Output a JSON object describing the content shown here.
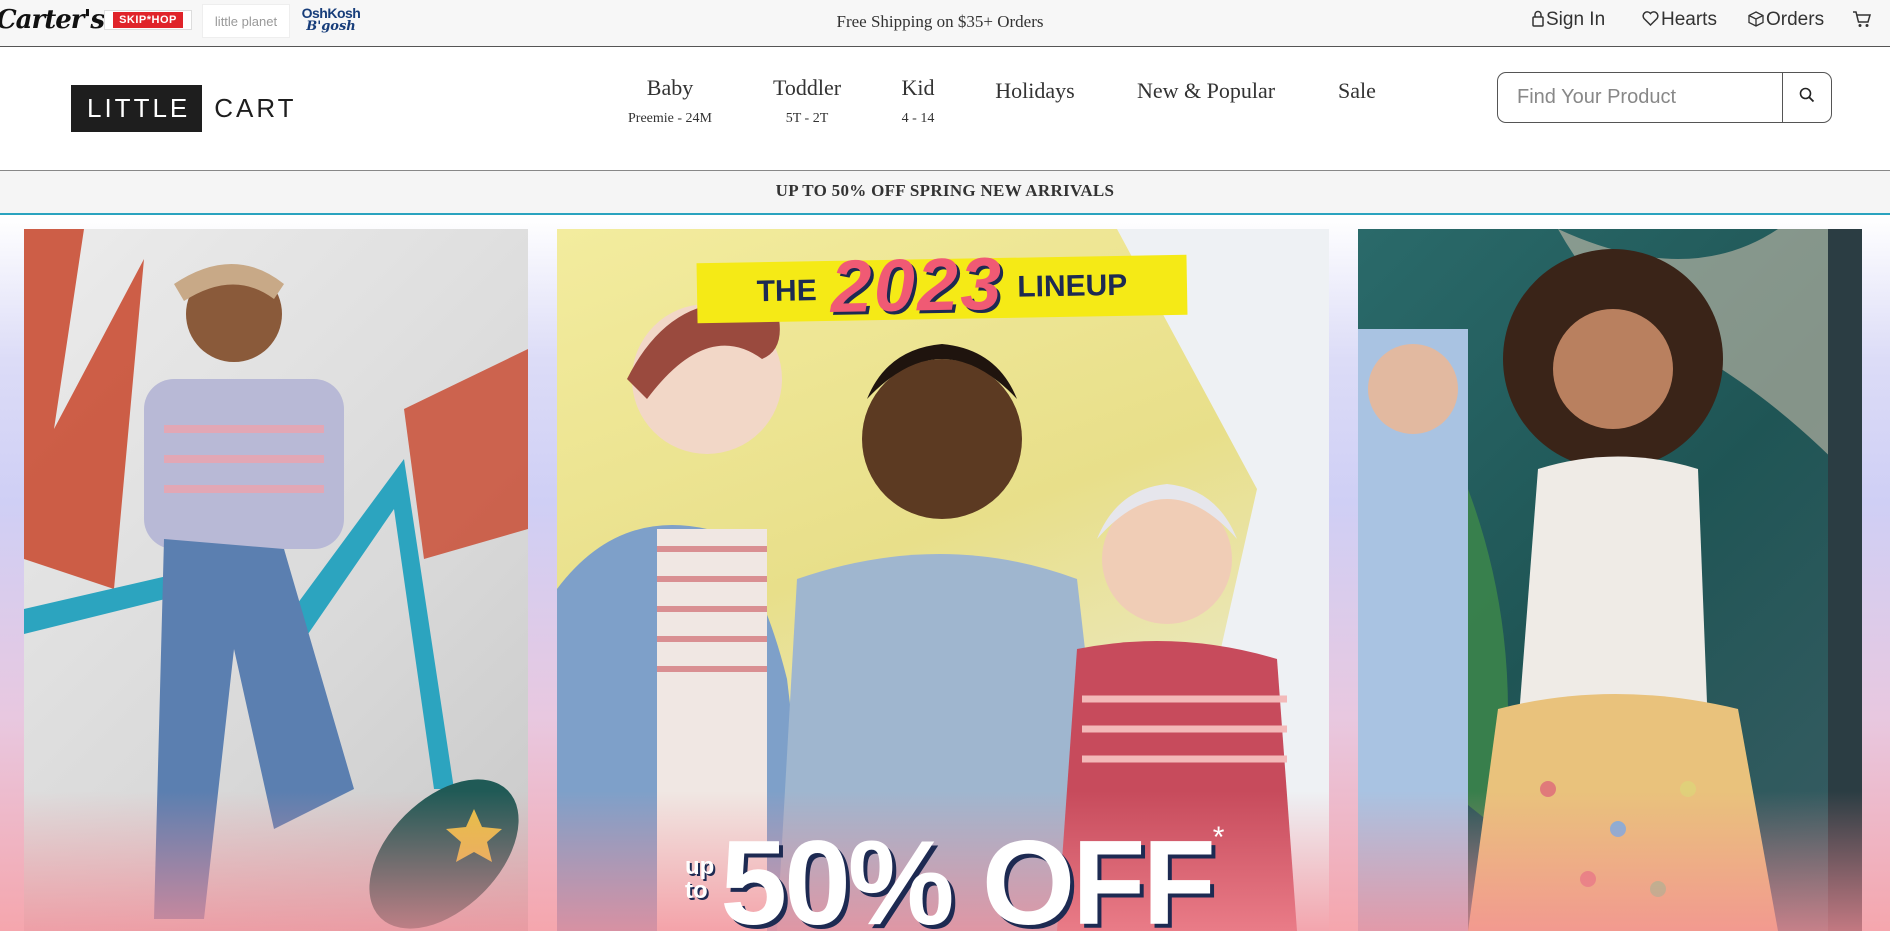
{
  "brands": {
    "carters": "Carter's",
    "skiphop": "SKIP*HOP",
    "little_planet": "little planet",
    "oshkosh_line1": "OshKosh",
    "oshkosh_line2": "B'gosh"
  },
  "topbar": {
    "promo": "Free Shipping on $35+ Orders",
    "sign_in": "Sign In",
    "hearts": "Hearts",
    "orders": "Orders"
  },
  "header": {
    "logo_dark": "LITTLE",
    "logo_light": "CART",
    "nav": [
      {
        "label": "Baby",
        "sub": "Preemie - 24M"
      },
      {
        "label": "Toddler",
        "sub": "5T - 2T"
      },
      {
        "label": "Kid",
        "sub": "4 - 14"
      },
      {
        "label": "Holidays",
        "sub": ""
      },
      {
        "label": "New & Popular",
        "sub": ""
      },
      {
        "label": "Sale",
        "sub": ""
      }
    ],
    "search_placeholder": "Find Your Product"
  },
  "announcement": "UP TO 50% OFF SPRING NEW ARRIVALS",
  "hero": {
    "headline_the": "THE",
    "headline_year": "2023",
    "headline_lineup": "LINEUP",
    "sale_upto_1": "up",
    "sale_upto_2": "to",
    "sale_amount": "50% OFF",
    "sale_mark": "*"
  },
  "icons": {
    "signin": "lock-icon",
    "hearts": "heart-icon",
    "orders": "box-icon",
    "cart": "cart-icon",
    "search": "search-icon"
  },
  "colors": {
    "accent_teal": "#2aa3bf",
    "skiphop_red": "#e0242a",
    "banner_yellow": "#f5ea16",
    "headline_pink": "#f05a74",
    "navy": "#1d2a52"
  }
}
